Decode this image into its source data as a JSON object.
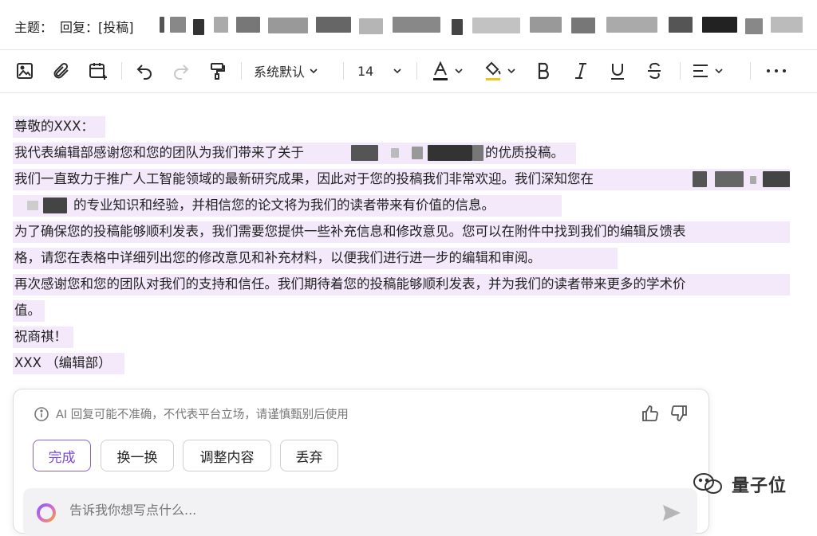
{
  "subject": {
    "label": "主题：",
    "value": "回复：[投稿]"
  },
  "toolbar": {
    "font_family": "系统默认",
    "font_size": "14",
    "items": [
      "image-icon",
      "attachment-icon",
      "calendar-add-icon",
      "undo-icon",
      "redo-icon",
      "format-painter-icon",
      "text-color-icon",
      "highlight-color-icon",
      "bold-icon",
      "italic-icon",
      "underline-icon",
      "strikethrough-icon",
      "align-icon",
      "more-icon"
    ],
    "text_color": "#1f1f1f",
    "highlight_color": "#f0c419"
  },
  "letter": {
    "l1": "尊敬的XXX：",
    "l2a": "我代表编辑部感谢您和您的团队为我们带来了关于",
    "l2b": "的优质投稿。",
    "l3a": "我们一直致力于推广人工智能领域的最新研究成果，因此对于您的投稿我们非常欢迎。我们深知您在",
    "l4b": "的专业知识和经验，并相信您的论文将为我们的读者带来有价值的信息。",
    "l5": "为了确保您的投稿能够顺利发表，我们需要您提供一些补充信息和修改意见。您可以在附件中找到我们的编辑反馈表",
    "l6": "格，请您在表格中详细列出您的修改意见和补充材料，以便我们进行进一步的编辑和审阅。",
    "l7": "再次感谢您和您的团队对我们的支持和信任。我们期待着您的投稿能够顺利发表，并为我们的读者带来更多的学术价",
    "l8": "值。",
    "l9": "祝商祺！",
    "l10": "XXX （编辑部）",
    "highlight_color": "#f3e9fb"
  },
  "ai_panel": {
    "notice": "AI 回复可能不准确，不代表平台立场，请谨慎甄别后使用",
    "buttons": {
      "done": "完成",
      "swap": "换一换",
      "adjust": "调整内容",
      "discard": "丢弃"
    },
    "prompt_placeholder": "告诉我你想写点什么...",
    "accent": "#7a4bd0"
  },
  "watermark": {
    "text": "量子位"
  }
}
